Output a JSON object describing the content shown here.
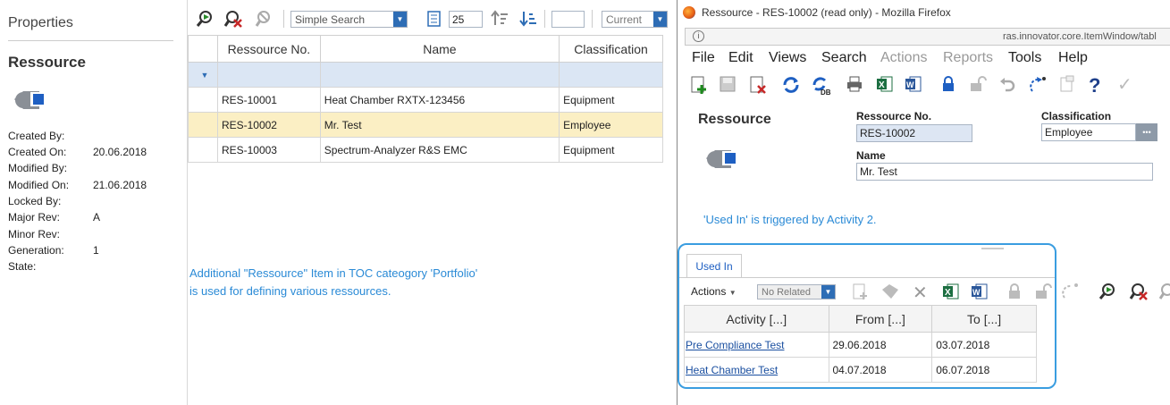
{
  "properties": {
    "title": "Properties",
    "item_type": "Ressource",
    "fields": [
      {
        "label": "Created By:",
        "value": ""
      },
      {
        "label": "Created On:",
        "value": "20.06.2018"
      },
      {
        "label": "Modified By:",
        "value": ""
      },
      {
        "label": "Modified On:",
        "value": "21.06.2018"
      },
      {
        "label": "Locked By:",
        "value": ""
      },
      {
        "label": "Major Rev:",
        "value": "A"
      },
      {
        "label": "Minor Rev:",
        "value": ""
      },
      {
        "label": "Generation:",
        "value": "1"
      },
      {
        "label": "State:",
        "value": ""
      }
    ]
  },
  "grid_toolbar": {
    "search_mode": "Simple Search",
    "page_size": "25",
    "page_input": "",
    "version_filter": "Current"
  },
  "grid": {
    "columns": [
      "Ressource No.",
      "Name",
      "Classification"
    ],
    "rows": [
      {
        "no": "RES-10001",
        "name": "Heat Chamber RXTX-123456",
        "classification": "Equipment"
      },
      {
        "no": "RES-10002",
        "name": "Mr. Test",
        "classification": "Employee"
      },
      {
        "no": "RES-10003",
        "name": "Spectrum-Analyzer R&S EMC",
        "classification": "Equipment"
      }
    ]
  },
  "annotation_left": {
    "line1": "Additional \"Ressource\" Item in TOC cateogory 'Portfolio'",
    "line2": "is used for defining various ressources."
  },
  "window": {
    "title": "Ressource - RES-10002 (read only) - Mozilla Firefox",
    "url": "ras.innovator.core.ItemWindow/tabl",
    "menu": [
      "File",
      "Edit",
      "Views",
      "Search",
      "Actions",
      "Reports",
      "Tools",
      "Help"
    ],
    "form": {
      "item_type": "Ressource",
      "ressource_no_label": "Ressource No.",
      "ressource_no_value": "RES-10002",
      "classification_label": "Classification",
      "classification_value": "Employee",
      "classification_button": "•••",
      "name_label": "Name",
      "name_value": "Mr. Test"
    },
    "annotation": "'Used In' is triggered by Activity 2.",
    "relationship": {
      "tab": "Used In",
      "actions_label": "Actions",
      "related_filter": "No Related",
      "columns": [
        "Activity [...]",
        "From [...]",
        "To [...]"
      ],
      "rows": [
        {
          "activity": "Pre Compliance Test",
          "from": "29.06.2018",
          "to": "03.07.2018"
        },
        {
          "activity": "Heat Chamber Test",
          "from": "04.07.2018",
          "to": "06.07.2018"
        }
      ]
    }
  },
  "colors": {
    "accent_blue": "#2e6db5",
    "selected_row": "#fbefc4",
    "filter_row": "#dbe6f4",
    "callout_border": "#3a9de0",
    "note_text": "#2a8ad6"
  }
}
